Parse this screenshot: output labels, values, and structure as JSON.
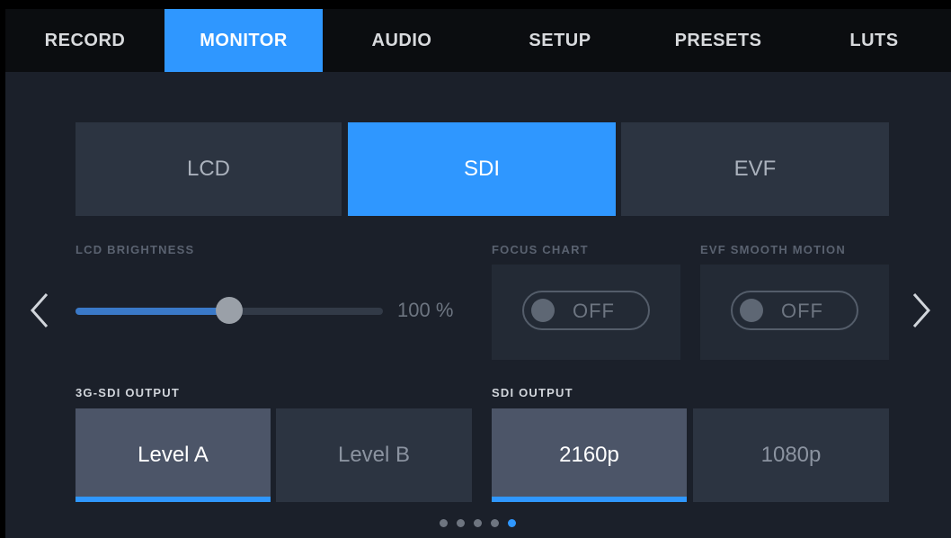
{
  "topnav": {
    "tabs": [
      {
        "label": "RECORD",
        "active": false
      },
      {
        "label": "MONITOR",
        "active": true
      },
      {
        "label": "AUDIO",
        "active": false
      },
      {
        "label": "SETUP",
        "active": false
      },
      {
        "label": "PRESETS",
        "active": false
      },
      {
        "label": "LUTS",
        "active": false
      }
    ]
  },
  "output_selector": {
    "options": [
      {
        "label": "LCD",
        "active": false
      },
      {
        "label": "SDI",
        "active": true
      },
      {
        "label": "EVF",
        "active": false
      }
    ]
  },
  "lcd_brightness": {
    "label": "LCD BRIGHTNESS",
    "value_text": "100 %",
    "fill_fraction": 0.5
  },
  "focus_chart": {
    "label": "FOCUS CHART",
    "state": "OFF"
  },
  "evf_smooth_motion": {
    "label": "EVF SMOOTH MOTION",
    "state": "OFF"
  },
  "sdi_3g_output": {
    "label": "3G-SDI OUTPUT",
    "options": [
      {
        "label": "Level A",
        "selected": true
      },
      {
        "label": "Level B",
        "selected": false
      }
    ]
  },
  "sdi_output": {
    "label": "SDI OUTPUT",
    "options": [
      {
        "label": "2160p",
        "selected": true
      },
      {
        "label": "1080p",
        "selected": false
      }
    ]
  },
  "pagination": {
    "total": 5,
    "current": 5
  },
  "nav": {
    "prev_icon": "chevron-left-icon",
    "next_icon": "chevron-right-icon"
  },
  "colors": {
    "accent": "#2f97ff",
    "background": "#1b202a",
    "panel": "#2c3441"
  }
}
